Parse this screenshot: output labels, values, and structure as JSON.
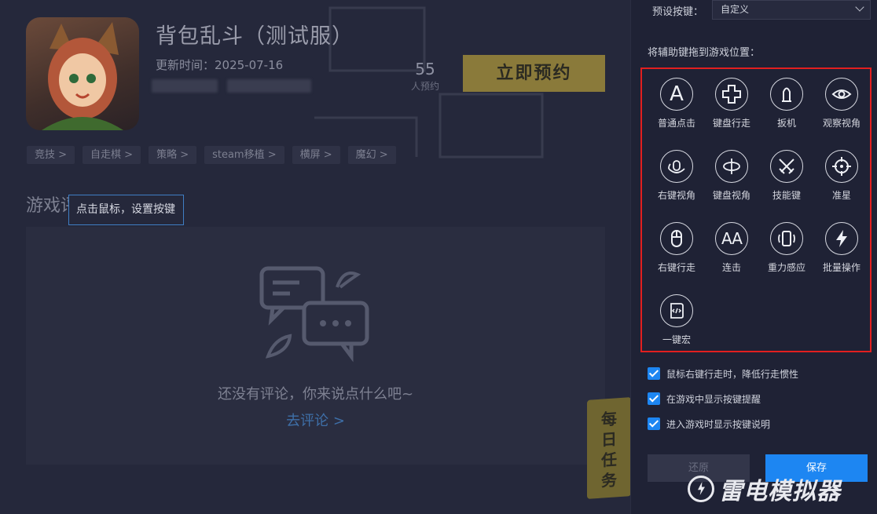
{
  "game": {
    "title": "背包乱斗（测试服）",
    "update_time": "更新时间：2025-07-16",
    "reserve_count": "55",
    "reserve_count_label": "人预约",
    "reserve_button": "立即预约",
    "tags": [
      "竞技 >",
      "自走棋 >",
      "策略 >",
      "steam移植 >",
      "横屏 >",
      "魔幻 >"
    ],
    "section_title": "游戏评论",
    "tooltip": "点击鼠标，设置按键",
    "empty_comment": "还没有评论，你来说点什么吧~",
    "go_comment": "去评论 >",
    "daily_task": [
      "每",
      "日",
      "任",
      "务"
    ]
  },
  "panel": {
    "preset_label": "预设按键：",
    "preset_value": "自定义",
    "drag_hint": "将辅助键拖到游戏位置：",
    "keys": [
      {
        "label": "普通点击",
        "icon": "letter-a-icon"
      },
      {
        "label": "键盘行走",
        "icon": "dpad-icon"
      },
      {
        "label": "扳机",
        "icon": "bullet-icon"
      },
      {
        "label": "观察视角",
        "icon": "eye-icon"
      },
      {
        "label": "右键视角",
        "icon": "mouse-rotate-icon"
      },
      {
        "label": "键盘视角",
        "icon": "rotate-icon"
      },
      {
        "label": "技能键",
        "icon": "crossed-swords-icon"
      },
      {
        "label": "准星",
        "icon": "crosshair-icon"
      },
      {
        "label": "右键行走",
        "icon": "mouse-icon"
      },
      {
        "label": "连击",
        "icon": "double-a-icon"
      },
      {
        "label": "重力感应",
        "icon": "phone-tilt-icon"
      },
      {
        "label": "批量操作",
        "icon": "lightning-icon"
      },
      {
        "label": "一键宏",
        "icon": "macro-script-icon"
      }
    ],
    "key_letter_a": "A",
    "key_letter_aa": "AA",
    "options": [
      {
        "label": "鼠标右键行走时，降低行走惯性",
        "checked": true
      },
      {
        "label": "在游戏中显示按键提醒",
        "checked": true
      },
      {
        "label": "进入游戏时显示按键说明",
        "checked": true
      }
    ],
    "reset_button": "还原",
    "save_button": "保存"
  },
  "watermark": "雷电模拟器",
  "colors": {
    "accent": "#1d86f2",
    "highlight_border": "#e21f1f",
    "reserve_button": "#8a7a3a"
  }
}
